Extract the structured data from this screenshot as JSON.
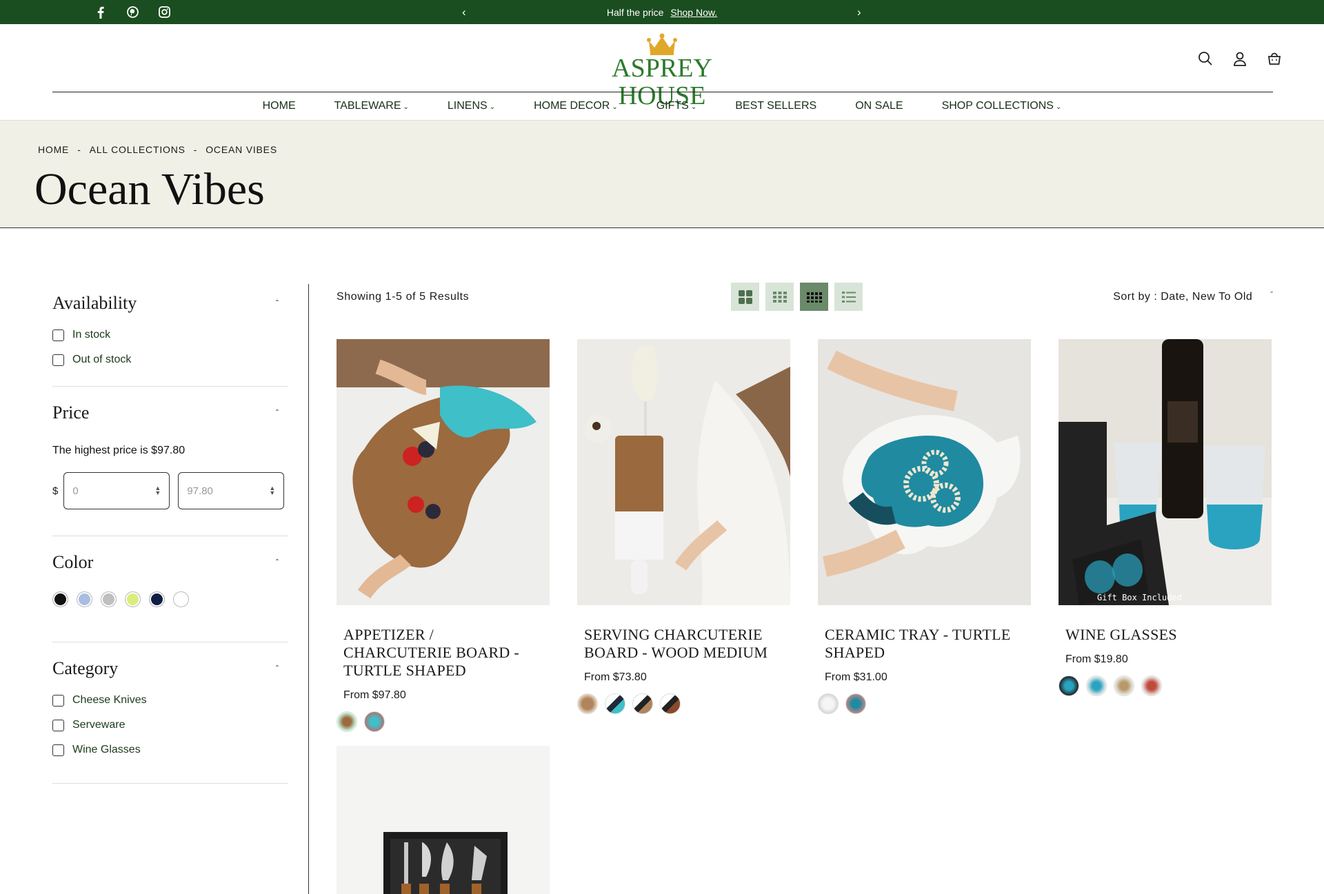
{
  "topbar": {
    "message": "Half the price",
    "link": "Shop Now.",
    "prev": "‹",
    "next": "›"
  },
  "brand": {
    "name": "ASPREY HOUSE",
    "color": "#2b7a2b"
  },
  "nav": [
    {
      "label": "HOME",
      "dropdown": false
    },
    {
      "label": "TABLEWARE",
      "dropdown": true
    },
    {
      "label": "LINENS",
      "dropdown": true
    },
    {
      "label": "HOME DECOR",
      "dropdown": true
    },
    {
      "label": "GIFTS",
      "dropdown": true
    },
    {
      "label": "BEST SELLERS",
      "dropdown": false
    },
    {
      "label": "ON SALE",
      "dropdown": false
    },
    {
      "label": "SHOP COLLECTIONS",
      "dropdown": true
    }
  ],
  "breadcrumb": {
    "home": "HOME",
    "sep": "-",
    "all": "ALL COLLECTIONS",
    "current": "OCEAN VIBES"
  },
  "page_title": "Ocean Vibes",
  "filters": {
    "availability": {
      "title": "Availability",
      "options": [
        "In stock",
        "Out of stock"
      ]
    },
    "price": {
      "title": "Price",
      "note": "The highest price is $97.80",
      "currency": "$",
      "min_placeholder": "0",
      "max_placeholder": "97.80"
    },
    "color": {
      "title": "Color",
      "swatches": [
        "#111111",
        "#a9bde0",
        "#bfbfbf",
        "#d9ee7a",
        "#0f1e45",
        "#ffffff"
      ]
    },
    "category": {
      "title": "Category",
      "options": [
        "Cheese Knives",
        "Serveware",
        "Wine Glasses"
      ]
    }
  },
  "toolbar": {
    "results": "Showing 1-5 of 5 Results",
    "sort_label": "Sort by :",
    "sort_value": "Date, New To Old",
    "active_view": 3
  },
  "products": [
    {
      "name": "APPETIZER / CHARCUTERIE BOARD - TURTLE SHAPED",
      "price": "From $97.80",
      "variants": 2
    },
    {
      "name": "SERVING CHARCUTERIE BOARD - WOOD MEDIUM",
      "price": "From $73.80",
      "variants": 4
    },
    {
      "name": "CERAMIC TRAY - TURTLE SHAPED",
      "price": "From $31.00",
      "variants": 2
    },
    {
      "name": "WINE GLASSES",
      "price": "From $19.80",
      "variants": 4,
      "image_caption": "Gift Box Included"
    },
    {
      "name": "",
      "price": "",
      "variants": 0
    }
  ],
  "colors": {
    "topbar": "#1a4d1f",
    "hero_bg": "#f1f0e6",
    "view_active": "#6a8a6a",
    "view_inactive": "#d8e4d8"
  }
}
